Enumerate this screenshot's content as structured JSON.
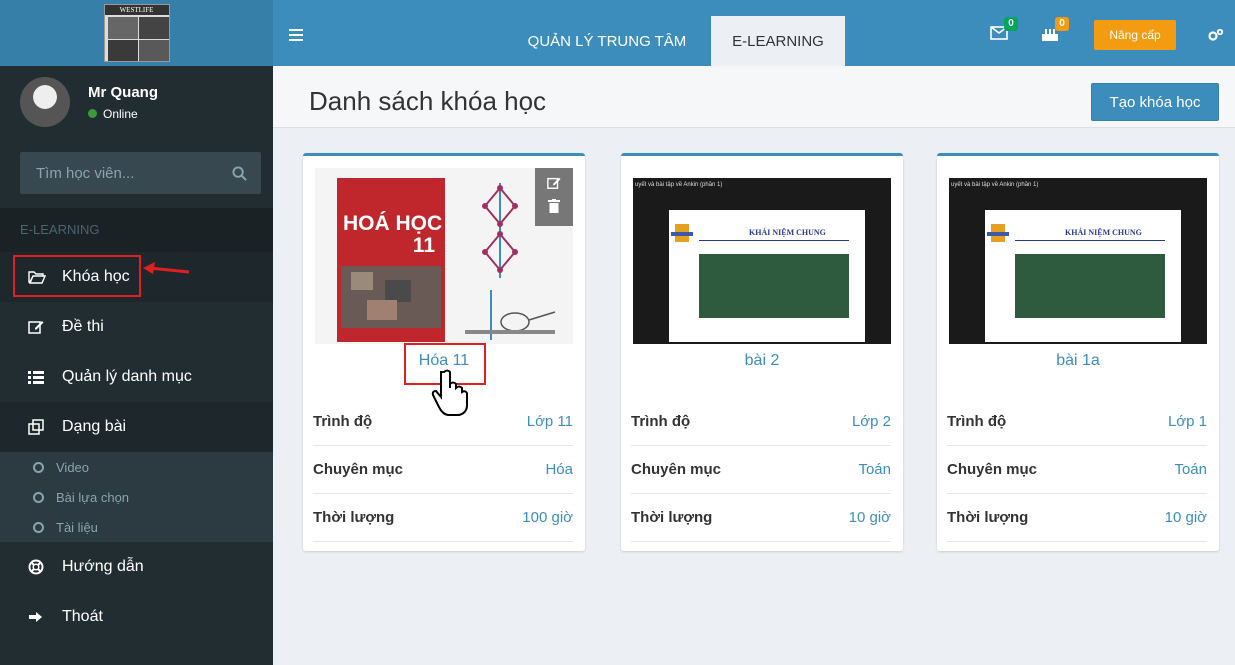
{
  "logo": {
    "text": "WESTLIFE"
  },
  "user": {
    "name": "Mr Quang",
    "status": "Online"
  },
  "search": {
    "placeholder": "Tìm học viên..."
  },
  "sidebar": {
    "header": "E-LEARNING",
    "items": [
      {
        "label": "Khóa học",
        "icon": "folder-open-icon"
      },
      {
        "label": "Đề thi",
        "icon": "edit-icon"
      },
      {
        "label": "Quản lý danh mục",
        "icon": "list-icon"
      },
      {
        "label": "Dạng bài",
        "icon": "clone-icon"
      },
      {
        "label": "Hướng dẫn",
        "icon": "life-ring-icon"
      },
      {
        "label": "Thoát",
        "icon": "sign-out-icon"
      }
    ],
    "subitems": [
      "Video",
      "Bài lựa chọn",
      "Tài liệu"
    ]
  },
  "topbar": {
    "tabs": [
      "QUẢN LÝ TRUNG TÂM",
      "E-LEARNING"
    ],
    "mail_count": "0",
    "notif_count": "0",
    "upgrade_label": "Nâng cấp"
  },
  "page": {
    "title": "Danh sách khóa học",
    "create_label": "Tạo khóa học"
  },
  "labels": {
    "level": "Trình độ",
    "category": "Chuyên mục",
    "duration": "Thời lượng"
  },
  "courses": [
    {
      "name": "Hóa 11",
      "level": "Lớp 11",
      "category": "Hóa",
      "duration": "100 giờ",
      "cover_title": "HOÁ HỌC",
      "cover_num": "11"
    },
    {
      "name": "bài 2",
      "level": "Lớp 2",
      "category": "Toán",
      "duration": "10 giờ",
      "video_title": "uyết và bài tập về Ankin (phần 1)",
      "slide_title": "KHÁI NIỆM CHUNG"
    },
    {
      "name": "bài 1a",
      "level": "Lớp 1",
      "category": "Toán",
      "duration": "10 giờ",
      "video_title": "uyết và bài tập về Ankin (phần 1)",
      "slide_title": "KHÁI NIỆM CHUNG"
    }
  ],
  "colors": {
    "brand": "#3c8dbc",
    "sidebar": "#222d32",
    "accent": "#f39c12",
    "online": "#00a65a"
  }
}
